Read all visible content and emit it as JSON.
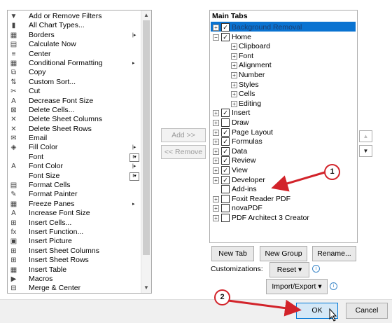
{
  "left_commands": [
    {
      "icon": "filter-icon",
      "glyph": "▼",
      "label": "Add or Remove Filters"
    },
    {
      "icon": "chart-icon",
      "glyph": "▮",
      "label": "All Chart Types..."
    },
    {
      "icon": "borders-icon",
      "glyph": "▦",
      "label": "Borders",
      "sub": "|▸"
    },
    {
      "icon": "calculator-icon",
      "glyph": "▤",
      "label": "Calculate Now"
    },
    {
      "icon": "center-icon",
      "glyph": "≡",
      "label": "Center"
    },
    {
      "icon": "conditional-format-icon",
      "glyph": "▦",
      "label": "Conditional Formatting",
      "sub": "▸"
    },
    {
      "icon": "copy-icon",
      "glyph": "⧉",
      "label": "Copy"
    },
    {
      "icon": "sort-icon",
      "glyph": "⇅",
      "label": "Custom Sort..."
    },
    {
      "icon": "cut-icon",
      "glyph": "✂",
      "label": "Cut"
    },
    {
      "icon": "font-size-down-icon",
      "glyph": "A",
      "label": "Decrease Font Size"
    },
    {
      "icon": "delete-cells-icon",
      "glyph": "⊠",
      "label": "Delete Cells..."
    },
    {
      "icon": "delete-columns-icon",
      "glyph": "✕",
      "label": "Delete Sheet Columns"
    },
    {
      "icon": "delete-rows-icon",
      "glyph": "✕",
      "label": "Delete Sheet Rows"
    },
    {
      "icon": "email-icon",
      "glyph": "✉",
      "label": "Email"
    },
    {
      "icon": "fill-color-icon",
      "glyph": "◈",
      "label": "Fill Color",
      "sub": "|▸"
    },
    {
      "icon": "",
      "glyph": "",
      "label": "Font",
      "box": "I▾"
    },
    {
      "icon": "font-color-icon",
      "glyph": "A",
      "label": "Font Color",
      "sub": "|▸"
    },
    {
      "icon": "",
      "glyph": "",
      "label": "Font Size",
      "box": "I▾"
    },
    {
      "icon": "format-cells-icon",
      "glyph": "▤",
      "label": "Format Cells"
    },
    {
      "icon": "format-painter-icon",
      "glyph": "✎",
      "label": "Format Painter"
    },
    {
      "icon": "freeze-panes-icon",
      "glyph": "▦",
      "label": "Freeze Panes",
      "sub": "▸"
    },
    {
      "icon": "font-size-up-icon",
      "glyph": "A",
      "label": "Increase Font Size"
    },
    {
      "icon": "insert-cells-icon",
      "glyph": "⊞",
      "label": "Insert Cells..."
    },
    {
      "icon": "function-icon",
      "glyph": "fx",
      "label": "Insert Function..."
    },
    {
      "icon": "picture-icon",
      "glyph": "▣",
      "label": "Insert Picture"
    },
    {
      "icon": "insert-columns-icon",
      "glyph": "⊞",
      "label": "Insert Sheet Columns"
    },
    {
      "icon": "insert-rows-icon",
      "glyph": "⊞",
      "label": "Insert Sheet Rows"
    },
    {
      "icon": "table-icon",
      "glyph": "▦",
      "label": "Insert Table"
    },
    {
      "icon": "macros-icon",
      "glyph": "▶",
      "label": "Macros"
    },
    {
      "icon": "merge-center-icon",
      "glyph": "⊟",
      "label": "Merge & Center"
    }
  ],
  "add_label": "Add >>",
  "remove_label": "<< Remove",
  "right_title": "Main Tabs",
  "tabs": [
    {
      "label": "Background Removal",
      "level": 0,
      "exp": "+",
      "checked": true,
      "selected": true
    },
    {
      "label": "Home",
      "level": 0,
      "exp": "−",
      "checked": true
    },
    {
      "label": "Clipboard",
      "level": 1,
      "exp": "+"
    },
    {
      "label": "Font",
      "level": 1,
      "exp": "+"
    },
    {
      "label": "Alignment",
      "level": 1,
      "exp": "+"
    },
    {
      "label": "Number",
      "level": 1,
      "exp": "+"
    },
    {
      "label": "Styles",
      "level": 1,
      "exp": "+"
    },
    {
      "label": "Cells",
      "level": 1,
      "exp": "+"
    },
    {
      "label": "Editing",
      "level": 1,
      "exp": "+"
    },
    {
      "label": "Insert",
      "level": 0,
      "exp": "+",
      "checked": true
    },
    {
      "label": "Draw",
      "level": 0,
      "exp": "+",
      "checked": false
    },
    {
      "label": "Page Layout",
      "level": 0,
      "exp": "+",
      "checked": true
    },
    {
      "label": "Formulas",
      "level": 0,
      "exp": "+",
      "checked": true
    },
    {
      "label": "Data",
      "level": 0,
      "exp": "+",
      "checked": true
    },
    {
      "label": "Review",
      "level": 0,
      "exp": "+",
      "checked": true
    },
    {
      "label": "View",
      "level": 0,
      "exp": "+",
      "checked": true
    },
    {
      "label": "Developer",
      "level": 0,
      "exp": "+",
      "checked": true
    },
    {
      "label": "Add-ins",
      "level": 0,
      "exp": "",
      "checked": false
    },
    {
      "label": "Foxit Reader PDF",
      "level": 0,
      "exp": "+",
      "checked": false
    },
    {
      "label": "novaPDF",
      "level": 0,
      "exp": "+",
      "checked": false
    },
    {
      "label": "PDF Architect 3 Creator",
      "level": 0,
      "exp": "+",
      "checked": false
    }
  ],
  "new_tab": "New Tab",
  "new_group": "New Group",
  "rename": "Rename...",
  "customizations_label": "Customizations:",
  "reset_label": "Reset ▾",
  "import_export_label": "Import/Export ▾",
  "ok_label": "OK",
  "cancel_label": "Cancel",
  "callout_1": "1",
  "callout_2": "2"
}
